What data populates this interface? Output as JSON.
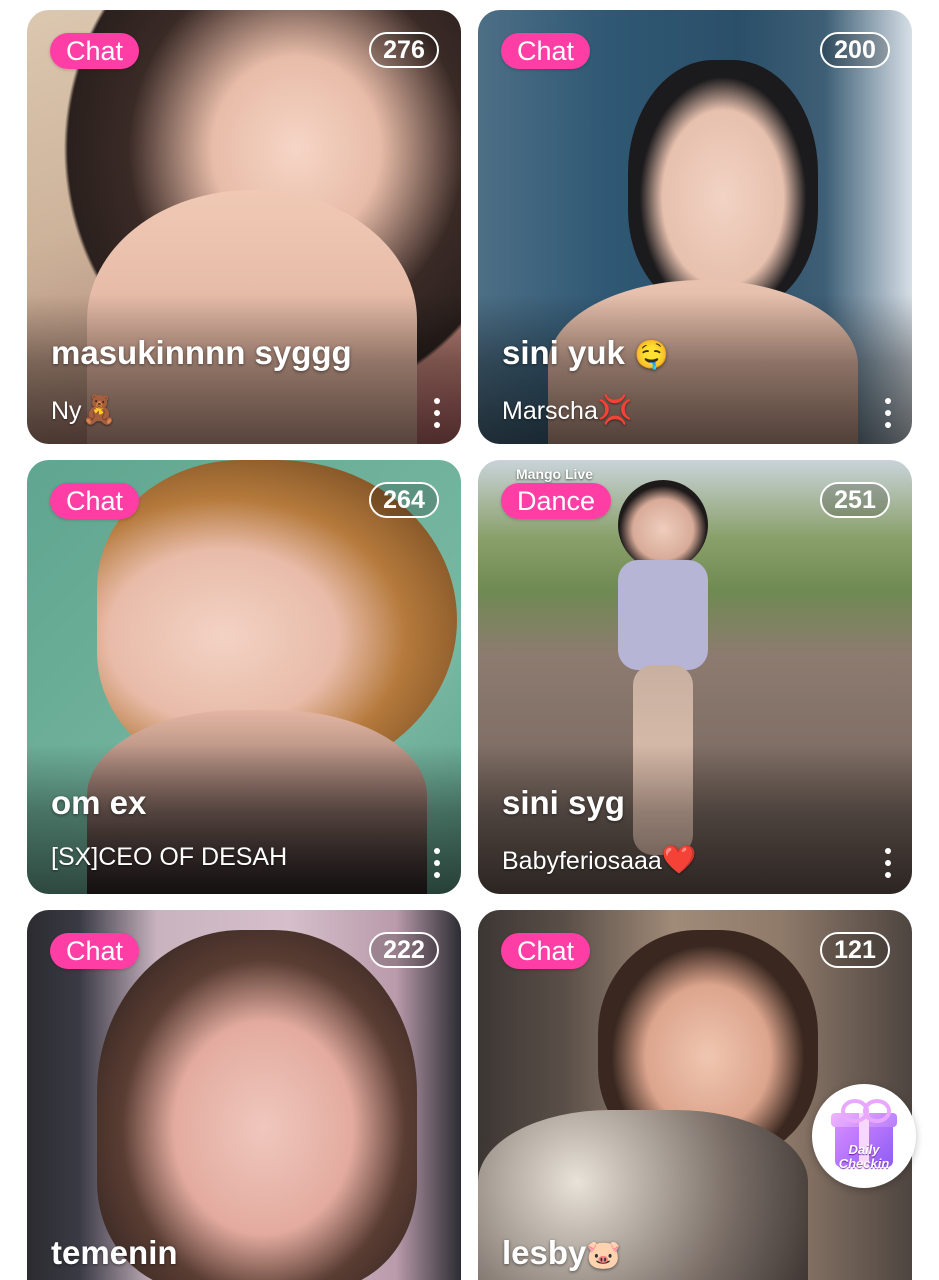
{
  "cards": [
    {
      "tag": "Chat",
      "count": "276",
      "title": "masukinnnn syggg",
      "host": "Ny",
      "host_emoji": "🧸",
      "title_emoji": ""
    },
    {
      "tag": "Chat",
      "count": "200",
      "title": "sini yuk",
      "title_emoji": "🤤",
      "host": "Marscha",
      "host_emoji": "💢"
    },
    {
      "tag": "Chat",
      "count": "264",
      "title": "om ex",
      "title_emoji": "",
      "host": "[SX]CEO OF DESAH",
      "host_emoji": ""
    },
    {
      "tag": "Dance",
      "count": "251",
      "title": "sini syg",
      "title_emoji": "",
      "host": "Babyferiosaaa",
      "host_emoji": "❤️",
      "watermark": "Mango Live"
    },
    {
      "tag": "Chat",
      "count": "222",
      "title": "temenin",
      "title_emoji": ""
    },
    {
      "tag": "Chat",
      "count": "121",
      "title": "lesby",
      "title_emoji": "🐷"
    }
  ],
  "daily_checkin": {
    "line1": "Daily",
    "line2": "Checkin"
  },
  "colors": {
    "tag_bg": "#ff3ea5",
    "text": "#ffffff"
  }
}
